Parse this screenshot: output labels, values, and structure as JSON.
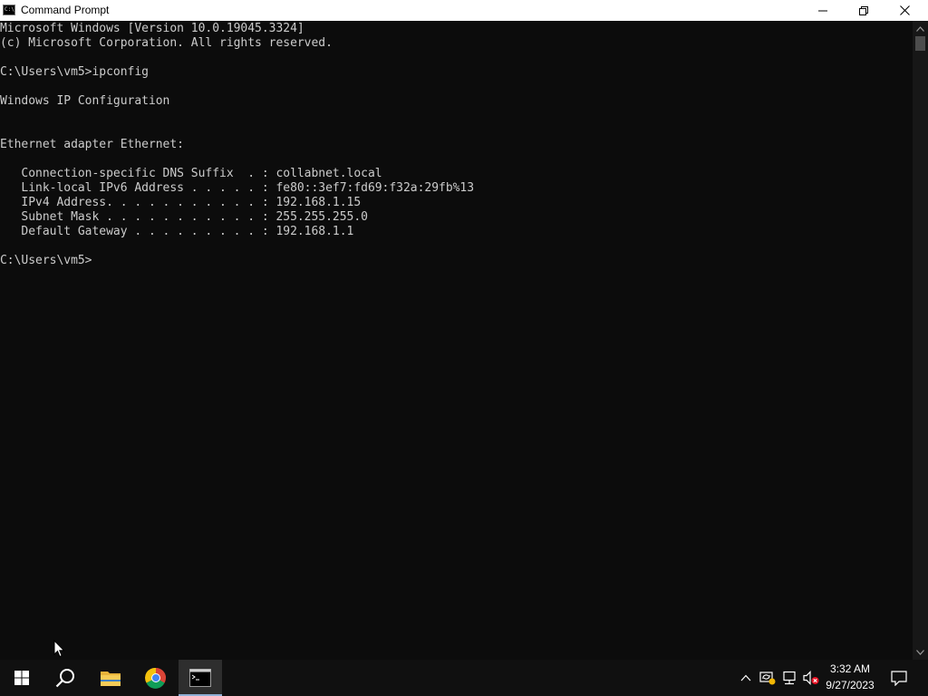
{
  "window": {
    "title": "Command Prompt",
    "icon_label": "C:\\",
    "controls": [
      "minimize-icon",
      "restore-icon",
      "close-icon"
    ]
  },
  "console": {
    "lines": [
      "Microsoft Windows [Version 10.0.19045.3324]",
      "(c) Microsoft Corporation. All rights reserved.",
      "",
      "C:\\Users\\vm5>ipconfig",
      "",
      "Windows IP Configuration",
      "",
      "",
      "Ethernet adapter Ethernet:",
      "",
      "   Connection-specific DNS Suffix  . : collabnet.local",
      "   Link-local IPv6 Address . . . . . : fe80::3ef7:fd69:f32a:29fb%13",
      "   IPv4 Address. . . . . . . . . . . : 192.168.1.15",
      "   Subnet Mask . . . . . . . . . . . : 255.255.255.0",
      "   Default Gateway . . . . . . . . . : 192.168.1.1",
      "",
      "C:\\Users\\vm5>"
    ]
  },
  "taskbar": {
    "apps": [
      "start-icon",
      "search-icon",
      "file-explorer-icon",
      "chrome-icon",
      "command-prompt-icon"
    ],
    "active_app": "command-prompt-icon",
    "tray_icons": [
      "show-hidden-icons-chevron",
      "network-sync-icon",
      "network-icon",
      "volume-muted-icon"
    ],
    "clock": {
      "time": "3:32 AM",
      "date": "9/27/2023"
    }
  },
  "colors": {
    "console_bg": "#0c0c0c",
    "console_text": "#cccccc",
    "taskbar_bg": "#101010",
    "titlebar_bg": "#ffffff"
  }
}
